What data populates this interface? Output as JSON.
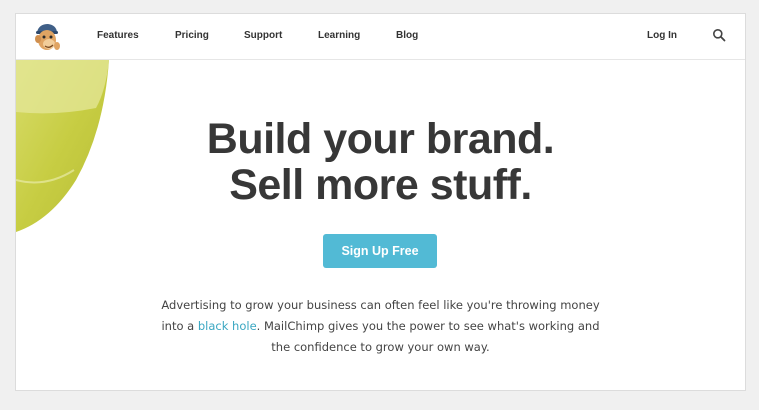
{
  "nav": {
    "items": [
      "Features",
      "Pricing",
      "Support",
      "Learning",
      "Blog"
    ],
    "login": "Log In"
  },
  "hero": {
    "headline_line1": "Build your brand.",
    "headline_line2": "Sell more stuff.",
    "cta": "Sign Up Free",
    "desc_line1": "Advertising to grow your business can often feel like you're throwing money",
    "desc_line2_before": "into a ",
    "desc_link": "black hole",
    "desc_line2_after": ". MailChimp gives you the power to see what's working and",
    "desc_line3": "the confidence to grow your own way."
  },
  "colors": {
    "accent": "#52bad5",
    "link": "#3aa7c2",
    "headline": "#373737",
    "blob": "#c9cf4a"
  },
  "icons": {
    "logo": "mailchimp-freddie-logo",
    "search": "search-icon"
  }
}
